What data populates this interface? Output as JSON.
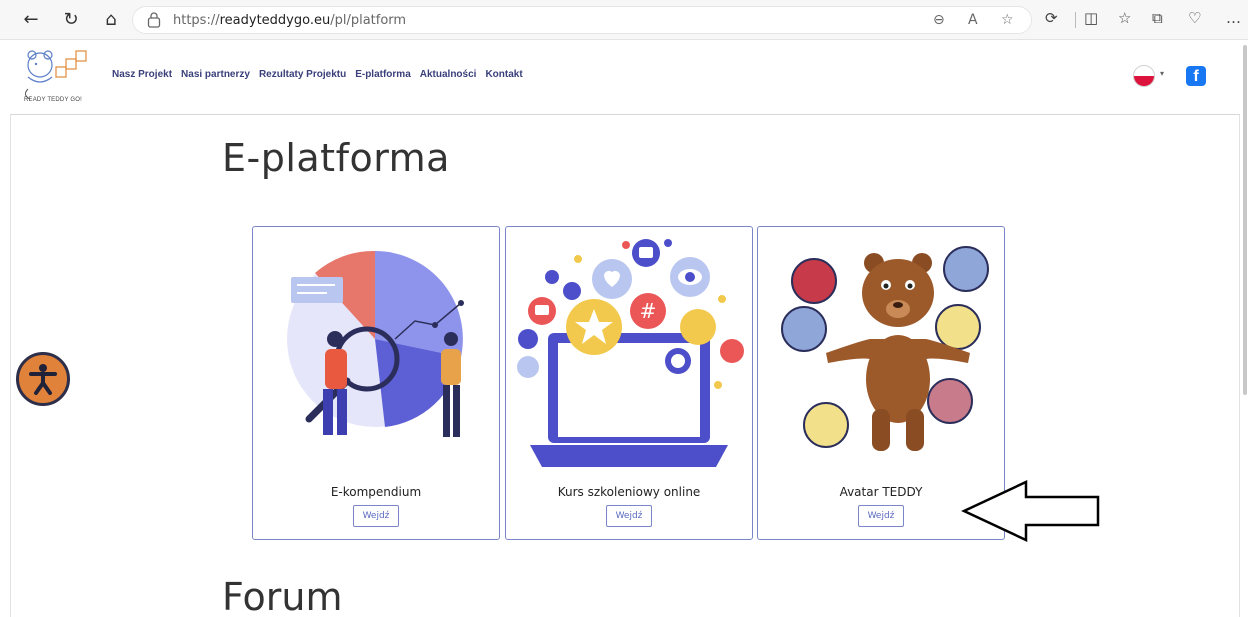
{
  "browser": {
    "url_prefix": "https://",
    "url_host": "readyteddygo.eu",
    "url_path": "/pl/platform"
  },
  "site": {
    "logo_text": "READY TEDDY GO!",
    "menu": [
      {
        "label": "Nasz Projekt"
      },
      {
        "label": "Nasi partnerzy"
      },
      {
        "label": "Rezultaty Projektu"
      },
      {
        "label": "E-platforma"
      },
      {
        "label": "Aktualności"
      },
      {
        "label": "Kontakt"
      }
    ],
    "facebook_glyph": "f"
  },
  "page": {
    "title": "E-platforma",
    "section2_title": "Forum",
    "cards": [
      {
        "label": "E-kompendium",
        "button": "Wejdź"
      },
      {
        "label": "Kurs szkoleniowy online",
        "button": "Wejdź"
      },
      {
        "label": "Avatar TEDDY",
        "button": "Wejdź"
      }
    ]
  },
  "colors": {
    "menu_link": "#3a3f7a",
    "card_border": "#7a86c8",
    "accessibility_bg": "#e0823a",
    "facebook": "#1877f2"
  }
}
